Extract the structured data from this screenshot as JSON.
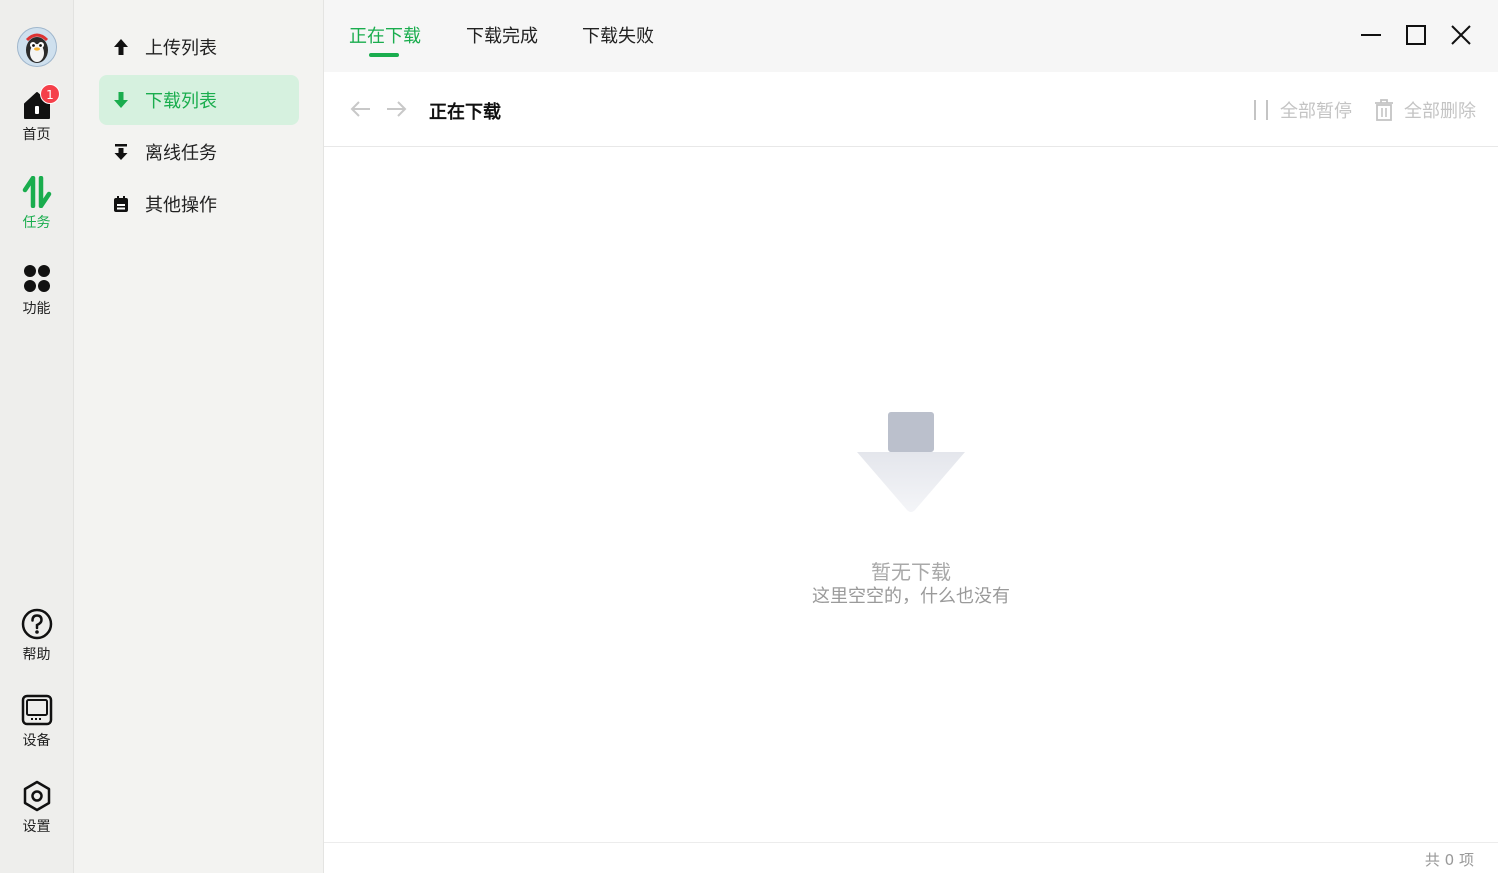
{
  "rail": {
    "items": [
      {
        "label": "首页",
        "icon": "home-icon",
        "badge": "1"
      },
      {
        "label": "任务",
        "icon": "transfer-icon"
      },
      {
        "label": "功能",
        "icon": "apps-icon"
      },
      {
        "label": "帮助",
        "icon": "help-icon"
      },
      {
        "label": "设备",
        "icon": "device-icon"
      },
      {
        "label": "设置",
        "icon": "settings-icon"
      }
    ],
    "active_color": "#1aad4e"
  },
  "sidebar": {
    "items": [
      {
        "label": "上传列表",
        "icon": "upload-arrow-icon"
      },
      {
        "label": "下载列表",
        "icon": "download-arrow-icon"
      },
      {
        "label": "离线任务",
        "icon": "offline-download-icon"
      },
      {
        "label": "其他操作",
        "icon": "clipboard-icon"
      }
    ]
  },
  "tabs": [
    "正在下载",
    "下载完成",
    "下载失败"
  ],
  "toolbar": {
    "breadcrumb": "正在下载",
    "pause_all": "全部暂停",
    "delete_all": "全部删除"
  },
  "empty": {
    "title": "暂无下载",
    "subtitle": "这里空空的，什么也没有"
  },
  "footer": {
    "count": "共 0 项"
  },
  "colors": {
    "accent": "#1aad4e",
    "badge": "#f5404a",
    "active_bg": "#d6f1df"
  }
}
